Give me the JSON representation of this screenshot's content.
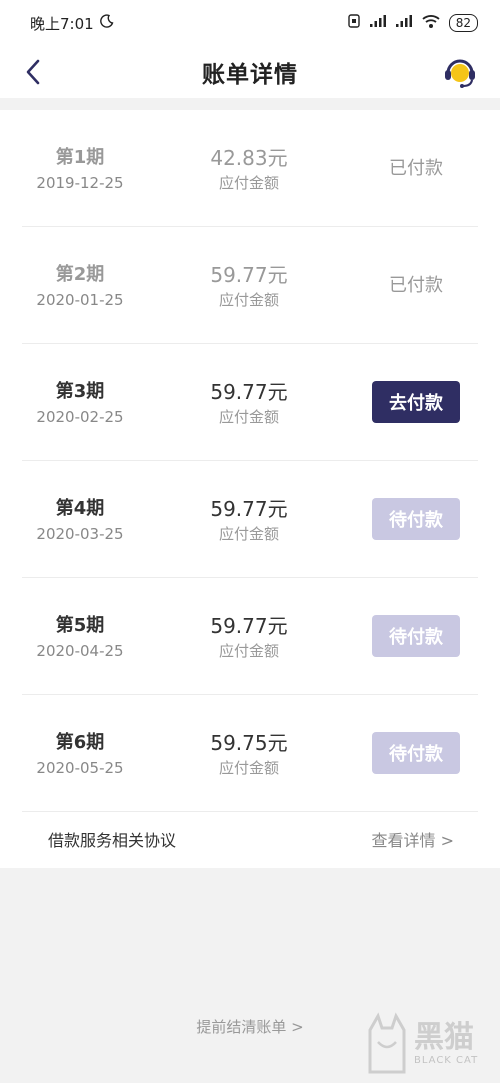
{
  "status_bar": {
    "time": "晚上7:01",
    "battery": "82"
  },
  "nav": {
    "title": "账单详情"
  },
  "bills": [
    {
      "period": "第1期",
      "date": "2019-12-25",
      "amount": "42.83元",
      "amount_label": "应付金额",
      "status": "已付款",
      "state": "paid"
    },
    {
      "period": "第2期",
      "date": "2020-01-25",
      "amount": "59.77元",
      "amount_label": "应付金额",
      "status": "已付款",
      "state": "paid"
    },
    {
      "period": "第3期",
      "date": "2020-02-25",
      "amount": "59.77元",
      "amount_label": "应付金额",
      "status": "去付款",
      "state": "active"
    },
    {
      "period": "第4期",
      "date": "2020-03-25",
      "amount": "59.77元",
      "amount_label": "应付金额",
      "status": "待付款",
      "state": "pending"
    },
    {
      "period": "第5期",
      "date": "2020-04-25",
      "amount": "59.77元",
      "amount_label": "应付金额",
      "status": "待付款",
      "state": "pending"
    },
    {
      "period": "第6期",
      "date": "2020-05-25",
      "amount": "59.75元",
      "amount_label": "应付金额",
      "status": "待付款",
      "state": "pending"
    }
  ],
  "agreement": {
    "label": "借款服务相关协议",
    "link": "查看详情 >"
  },
  "settle_link": "提前结清账单 >",
  "watermark": {
    "main": "黑猫",
    "sub": "BLACK CAT"
  },
  "colors": {
    "primary": "#2f2e63",
    "pending": "#c9c8e2",
    "service_icon": "#f5c518"
  }
}
